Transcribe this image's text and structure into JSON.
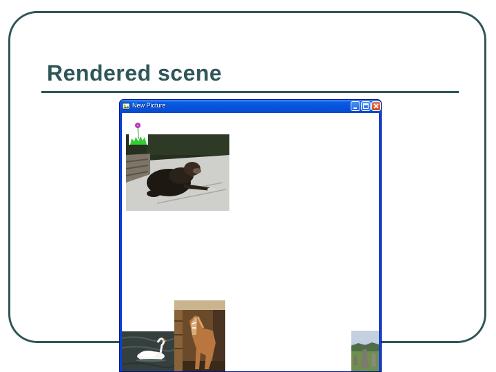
{
  "slide": {
    "title": "Rendered scene"
  },
  "window": {
    "title": "New Picture",
    "buttons": {
      "minimize": "minimize-icon",
      "maximize": "maximize-icon",
      "close": "close-icon"
    }
  },
  "colors": {
    "frame": "#2f5658",
    "title_text": "#2f5658",
    "xp_titlebar": "#0453dd",
    "xp_close": "#c8461e",
    "canvas": "#ffffff"
  },
  "scene_pictures": [
    "flower",
    "dog",
    "horse",
    "swan",
    "standing-stones"
  ]
}
